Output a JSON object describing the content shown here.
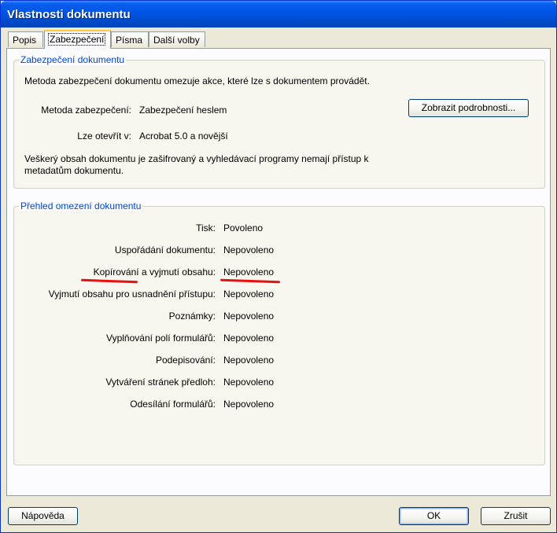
{
  "window": {
    "title": "Vlastnosti dokumentu"
  },
  "tabs": [
    {
      "label": "Popis",
      "active": false
    },
    {
      "label": "Zabezpečení",
      "active": true
    },
    {
      "label": "Písma",
      "active": false
    },
    {
      "label": "Další volby",
      "active": false
    }
  ],
  "security": {
    "group_title": "Zabezpečení dokumentu",
    "intro": "Metoda zabezpečení dokumentu omezuje akce, které lze s dokumentem provádět.",
    "method_label": "Metoda zabezpečení:",
    "method_value": "Zabezpečení heslem",
    "details_button": "Zobrazit podrobnosti...",
    "open_label": "Lze otevřít v:",
    "open_value": "Acrobat 5.0 a novější",
    "note_line1": "Veškerý obsah dokumentu je zašifrovaný a vyhledávací programy nemají přístup k",
    "note_line2": "metadatům dokumentu."
  },
  "restrictions": {
    "group_title": "Přehled omezení dokumentu",
    "rows": [
      {
        "label": "Tisk:",
        "value": "Povoleno"
      },
      {
        "label": "Uspořádání dokumentu:",
        "value": "Nepovoleno"
      },
      {
        "label": "Kopírování a vyjmutí obsahu:",
        "value": "Nepovoleno"
      },
      {
        "label": "Vyjmutí obsahu pro usnadnění přístupu:",
        "value": "Nepovoleno"
      },
      {
        "label": "Poznámky:",
        "value": "Nepovoleno"
      },
      {
        "label": "Vyplňování polí formulářů:",
        "value": "Nepovoleno"
      },
      {
        "label": "Podepisování:",
        "value": "Nepovoleno"
      },
      {
        "label": "Vytváření stránek předloh:",
        "value": "Nepovoleno"
      },
      {
        "label": "Odesílání formulářů:",
        "value": "Nepovoleno"
      }
    ]
  },
  "footer": {
    "help": "Nápověda",
    "ok": "OK",
    "cancel": "Zrušit"
  },
  "colors": {
    "title_bar": "#0054e3",
    "group_title": "#0046d5",
    "highlight_underline": "#e81010"
  }
}
